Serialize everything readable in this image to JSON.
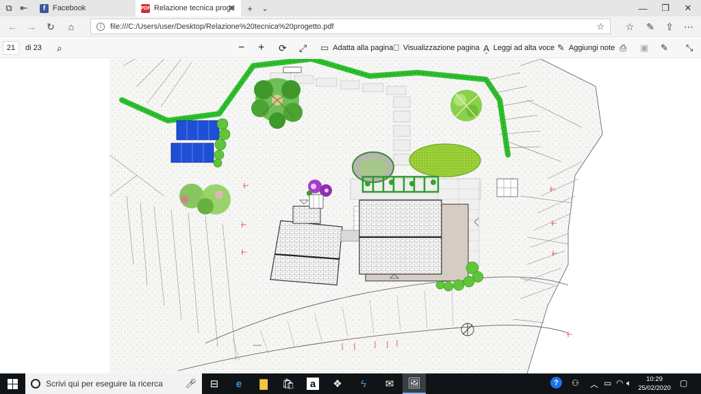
{
  "browser": {
    "tabs": [
      {
        "title": "Facebook",
        "icon": "facebook-icon",
        "active": false
      },
      {
        "title": "Relazione tecnica proge",
        "icon": "pdf-icon",
        "active": true
      }
    ],
    "address": "file:///C:/Users/user/Desktop/Relazione%20tecnica%20progetto.pdf",
    "window_controls": [
      "minimize-icon",
      "restore-icon",
      "close-icon"
    ]
  },
  "pdf_toolbar": {
    "page_current": "21",
    "page_total": "di 23",
    "fit_page": "Adatta alla pagina",
    "page_view": "Visualizzazione pagina",
    "read_aloud": "Leggi ad alta voce",
    "add_notes": "Aggiungi note"
  },
  "taskbar": {
    "search_placeholder": "Scrivi qui per eseguire la ricerca",
    "time": "10:29",
    "date": "25/02/2020"
  },
  "colors": {
    "hedge": "#2fbf2f",
    "solar": "#1f4fd6",
    "tree": "#3daa3d",
    "taskbar": "#111417",
    "accent": "#0078d7"
  }
}
